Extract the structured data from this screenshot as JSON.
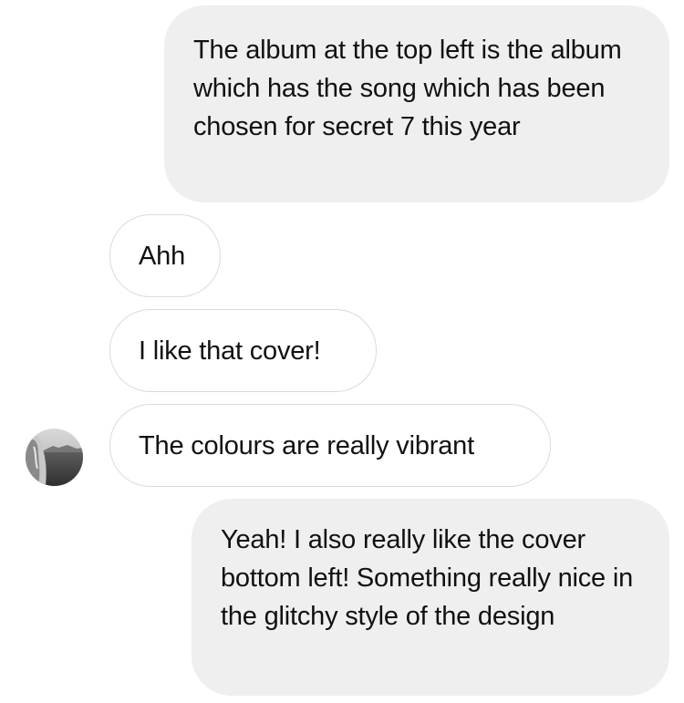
{
  "messages": [
    {
      "direction": "outgoing",
      "text": "The album at the top left is the album which has the song which has been chosen for secret 7 this year"
    },
    {
      "direction": "incoming",
      "text": "Ahh"
    },
    {
      "direction": "incoming",
      "text": "I like that cover!"
    },
    {
      "direction": "incoming",
      "text": "The colours are really vibrant"
    },
    {
      "direction": "outgoing",
      "text": "Yeah! I also really like the cover bottom left! Something really nice in the glitchy style of the design"
    }
  ],
  "colors": {
    "outgoing_bubble": "#efefef",
    "incoming_border": "#dbdbdb",
    "text": "#111111"
  },
  "icons": {
    "avatar": "avatar-photo"
  }
}
